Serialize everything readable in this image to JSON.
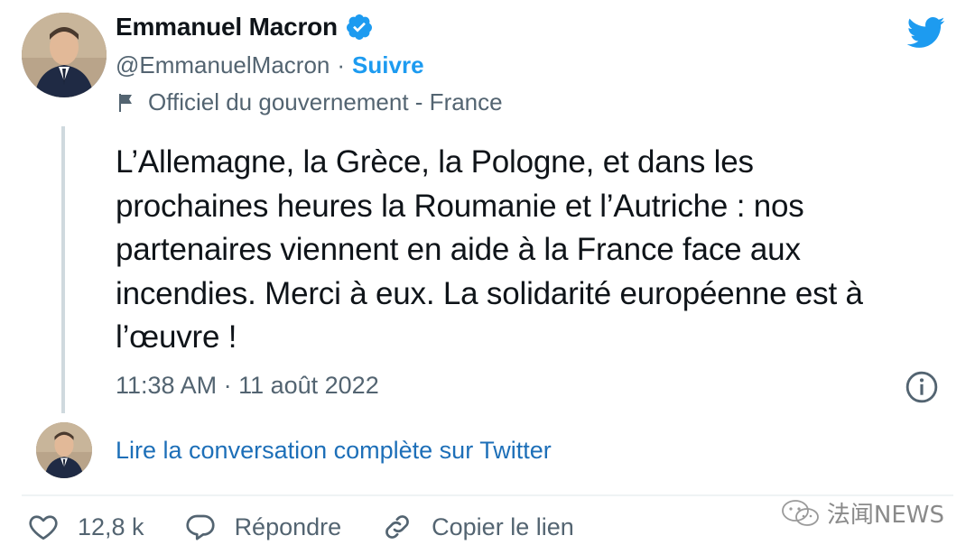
{
  "author": {
    "display_name": "Emmanuel Macron",
    "handle": "@EmmanuelMacron",
    "separator": "·",
    "follow_label": "Suivre",
    "label": "Officiel du gouvernement - France"
  },
  "tweet": {
    "text": "L’Allemagne, la Grèce, la Pologne, et dans les\nprochaines heures la Roumanie et l’Autriche : nos\npartenaires viennent en aide à la France face aux\nincendies. Merci à eux. La solidarité européenne est à\nl’œuvre !",
    "timestamp": "11:38 AM · 11 août 2022"
  },
  "conversation_link": "Lire la conversation complète sur Twitter",
  "actions": {
    "like_count": "12,8 k",
    "reply_label": "Répondre",
    "copy_link_label": "Copier le lien"
  },
  "watermark": "法闻NEWS",
  "colors": {
    "accent": "#1d9bf0",
    "text": "#0f1419",
    "secondary": "#536471",
    "link": "#1d6fb8"
  },
  "icons": [
    "verified-badge-icon",
    "twitter-bird-icon",
    "flag-icon",
    "info-icon",
    "heart-icon",
    "reply-icon",
    "link-icon",
    "wechat-icon"
  ]
}
